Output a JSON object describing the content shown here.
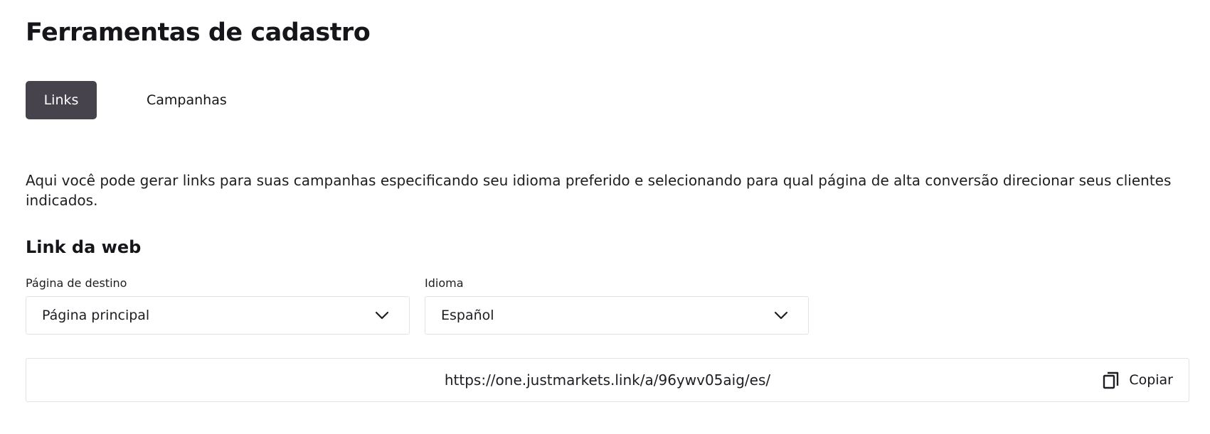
{
  "page": {
    "title": "Ferramentas de cadastro"
  },
  "tabs": [
    {
      "label": "Links",
      "active": true
    },
    {
      "label": "Campanhas",
      "active": false
    }
  ],
  "description": "Aqui você pode gerar links para suas campanhas especificando seu idioma preferido e selecionando para qual página de alta conversão direcionar seus clientes indicados.",
  "web_link": {
    "section_title": "Link da web",
    "destination": {
      "label": "Página de destino",
      "value": "Página principal",
      "icon": "chevron-down-icon"
    },
    "language": {
      "label": "Idioma",
      "value": "Español",
      "icon": "chevron-down-icon"
    },
    "generated_link": {
      "url": "https://one.justmarkets.link/a/96ywv05aig/es/",
      "copy_label": "Copiar",
      "copy_icon": "copy-icon"
    }
  },
  "colors": {
    "active_tab_bg": "#46434c",
    "active_tab_text": "#ffffff",
    "border": "#e3e3e7",
    "text": "#1d1d22"
  }
}
